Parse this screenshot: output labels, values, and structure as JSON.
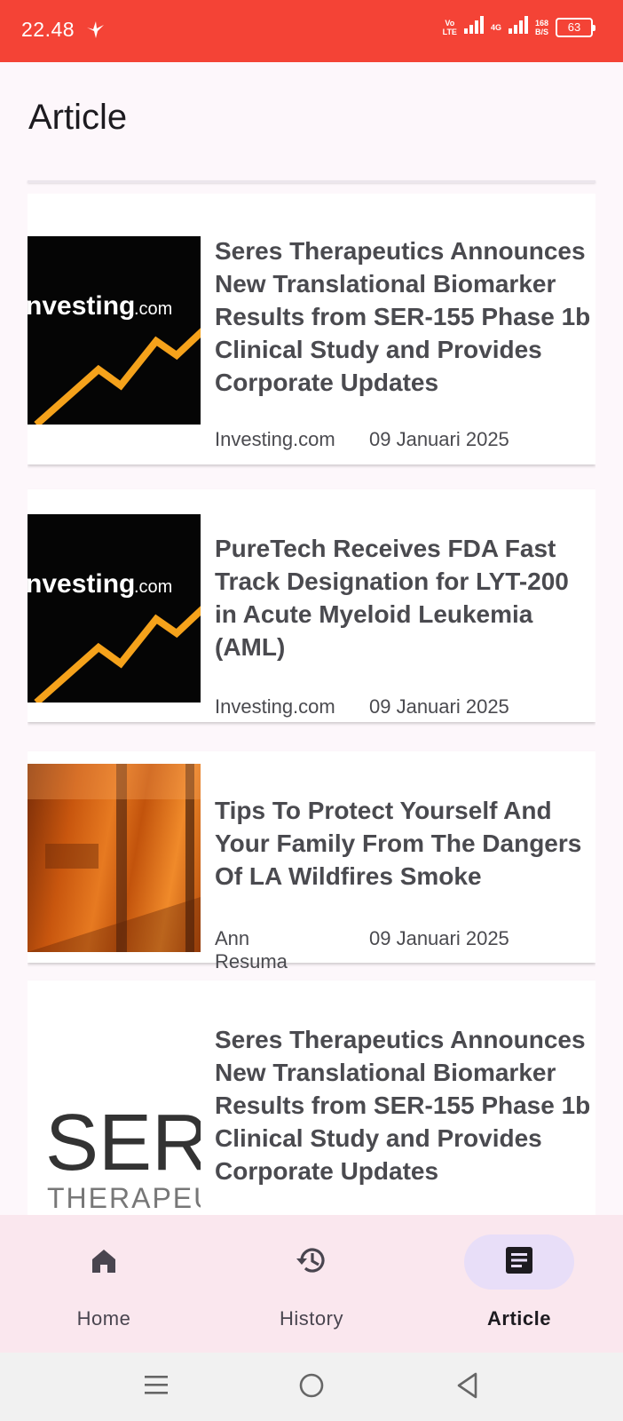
{
  "status_bar": {
    "time": "22.48",
    "network_label_1_top": "Vo",
    "network_label_1_bottom": "LTE",
    "network_label_2": "4G",
    "speed_value": "168",
    "speed_unit": "B/S",
    "battery": "63"
  },
  "page": {
    "title": "Article"
  },
  "articles": [
    {
      "title": "Seres Therapeutics Announces New Translational Biomarker Results from SER-155 Phase 1b Clinical Study and Provides Corporate Updates",
      "source": "Investing.com",
      "date": "09 Januari 2025",
      "thumbnail": "investing-logo",
      "thumb_text_brand": "nvesting",
      "thumb_text_suffix": ".com"
    },
    {
      "title": "PureTech Receives FDA Fast Track Designation for LYT-200 in Acute Myeloid Leukemia (AML)",
      "source": "Investing.com",
      "date": "09 Januari 2025",
      "thumbnail": "investing-logo",
      "thumb_text_brand": "nvesting",
      "thumb_text_suffix": ".com"
    },
    {
      "title": "Tips To Protect Yourself And Your Family From The Dangers Of LA Wildfires Smoke",
      "source": "Ann Resuma",
      "date": "09 Januari 2025",
      "thumbnail": "wildfire-photo"
    },
    {
      "title": "Seres Therapeutics Announces New Translational Biomarker Results from SER-155 Phase 1b Clinical Study and Provides Corporate Updates",
      "source": "",
      "date": "",
      "thumbnail": "seres-logo",
      "thumb_text_main": "SERI",
      "thumb_text_sub": "THERAPEU"
    }
  ],
  "bottom_nav": {
    "items": [
      {
        "label": "Home",
        "icon": "home-icon",
        "active": false
      },
      {
        "label": "History",
        "icon": "history-icon",
        "active": false
      },
      {
        "label": "Article",
        "icon": "article-icon",
        "active": true
      }
    ]
  },
  "colors": {
    "status_bar": "#f44336",
    "background": "#fdf7fb",
    "nav_background": "#fae7ee",
    "nav_active_pill": "#e8def8",
    "investing_orange": "#f5a21b"
  }
}
